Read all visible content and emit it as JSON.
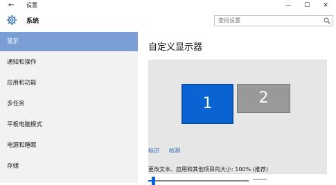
{
  "window": {
    "title": "设置",
    "back_symbol": "←",
    "minimize_symbol": "—",
    "maximize_symbol": "☐",
    "close_symbol": "✕"
  },
  "header": {
    "title": "系统",
    "icon": "gear-icon",
    "search_placeholder": "查找设置"
  },
  "sidebar": {
    "items": [
      {
        "label": "显示",
        "active": true
      },
      {
        "label": "通知和操作",
        "active": false
      },
      {
        "label": "应用和功能",
        "active": false
      },
      {
        "label": "多任务",
        "active": false
      },
      {
        "label": "平板电脑模式",
        "active": false
      },
      {
        "label": "电源和睡眠",
        "active": false
      },
      {
        "label": "存储",
        "active": false
      }
    ]
  },
  "main": {
    "title": "自定义显示器",
    "monitors": [
      {
        "label": "1",
        "selected": true,
        "color": "#0a63d2"
      },
      {
        "label": "2",
        "selected": false,
        "color": "#999999"
      }
    ],
    "identify_link": "标识",
    "detect_link": "检测",
    "scale_label": "更改文本、应用和其他项目的大小: 100% (推荐)",
    "scale_level": 0.05
  },
  "colors": {
    "accent": "#0a63d2",
    "sidebar_active": "#7a9fd6",
    "sidebar_bg": "#f2f2f2"
  }
}
